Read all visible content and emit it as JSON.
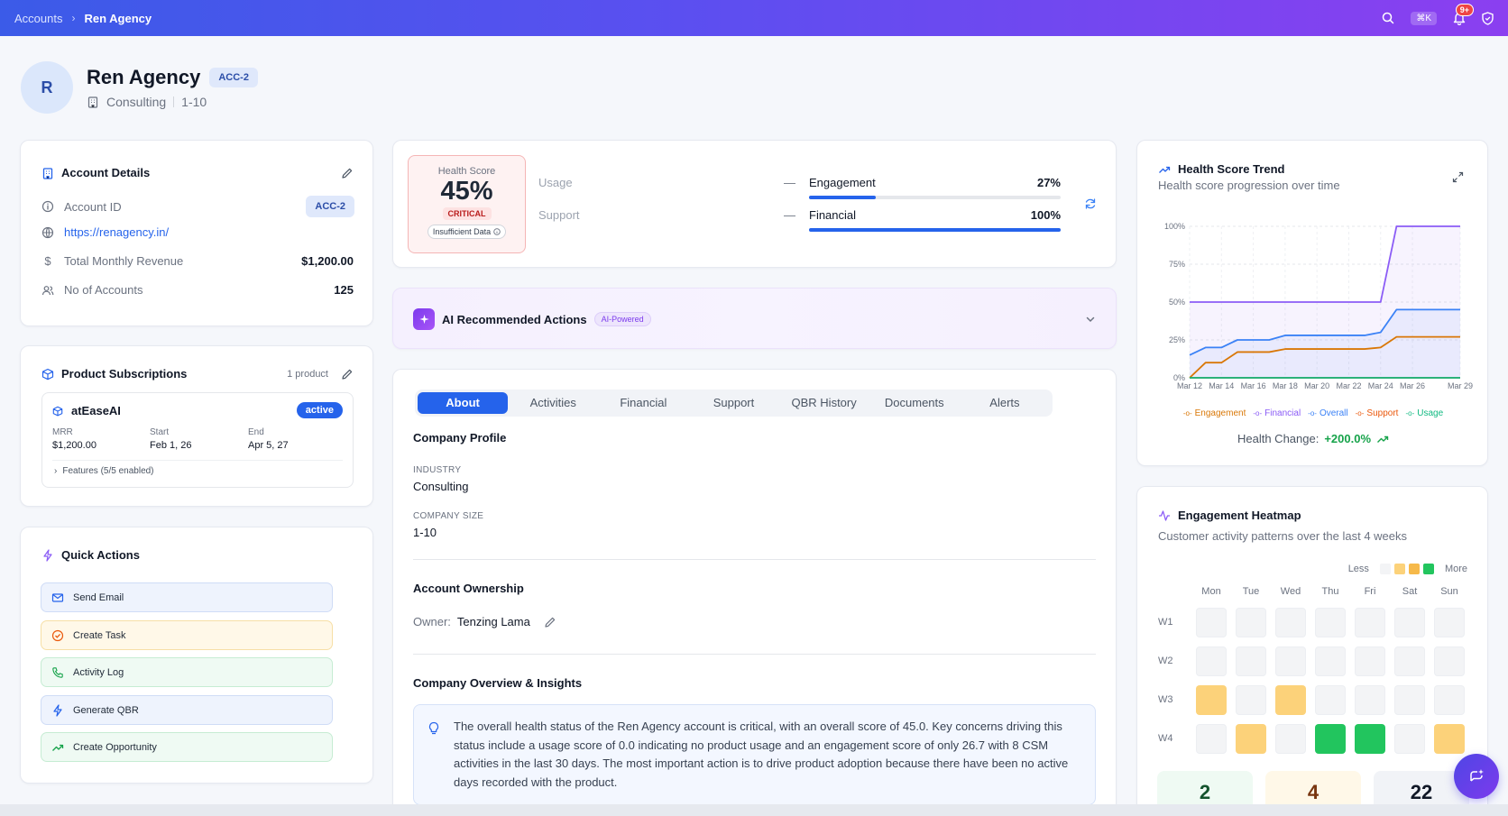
{
  "breadcrumb": {
    "parent": "Accounts",
    "current": "Ren Agency"
  },
  "topbar": {
    "kbd": "⌘K",
    "notifications": "9+"
  },
  "account": {
    "initial": "R",
    "name": "Ren Agency",
    "code": "ACC-2",
    "industry": "Consulting",
    "size": "1-10"
  },
  "details": {
    "title": "Account Details",
    "account_id_label": "Account ID",
    "account_id": "ACC-2",
    "website": "https://renagency.in/",
    "mrr_label": "Total Monthly Revenue",
    "mrr": "$1,200.00",
    "accounts_label": "No of Accounts",
    "accounts": "125"
  },
  "subscriptions": {
    "title": "Product Subscriptions",
    "count": "1 product",
    "product": "atEaseAI",
    "status": "active",
    "mrr_label": "MRR",
    "mrr": "$1,200.00",
    "start_label": "Start",
    "start": "Feb 1, 26",
    "end_label": "End",
    "end": "Apr 5, 27",
    "features": "Features (5/5 enabled)"
  },
  "quick_actions": {
    "title": "Quick Actions",
    "items": [
      "Send Email",
      "Create Task",
      "Activity Log",
      "Generate QBR",
      "Create Opportunity"
    ]
  },
  "health": {
    "label": "Health Score",
    "score": "45%",
    "status": "CRITICAL",
    "note": "Insufficient Data",
    "usage_label": "Usage",
    "usage_value": "—",
    "support_label": "Support",
    "support_value": "—",
    "engagement_label": "Engagement",
    "engagement_pct": "27%",
    "engagement_fill": 0.267,
    "financial_label": "Financial",
    "financial_pct": "100%",
    "financial_fill": 1.0
  },
  "ai": {
    "title": "AI Recommended Actions",
    "badge": "AI-Powered"
  },
  "tabs": [
    "About",
    "Activities",
    "Financial",
    "Support",
    "QBR History",
    "Documents",
    "Alerts"
  ],
  "about": {
    "profile_title": "Company Profile",
    "industry_label": "INDUSTRY",
    "industry": "Consulting",
    "size_label": "COMPANY SIZE",
    "size": "1-10",
    "ownership_title": "Account Ownership",
    "owner_label": "Owner:",
    "owner": "Tenzing Lama",
    "overview_title": "Company Overview & Insights",
    "overview_text": "The overall health status of the Ren Agency account is critical, with an overall score of 45.0. Key concerns driving this status include a usage score of 0.0 indicating no product usage and an engagement score of only 26.7 with 8 CSM activities in the last 30 days. The most important action is to drive product adoption because there have been no active days recorded with the product."
  },
  "trend": {
    "title": "Health Score Trend",
    "subtitle": "Health score progression over time",
    "change_label": "Health Change:",
    "change_value": "+200.0%"
  },
  "chart_data": {
    "type": "line",
    "x": [
      "Mar 12",
      "Mar 13",
      "Mar 14",
      "Mar 15",
      "Mar 16",
      "Mar 17",
      "Mar 18",
      "Mar 19",
      "Mar 20",
      "Mar 21",
      "Mar 22",
      "Mar 23",
      "Mar 24",
      "Mar 25",
      "Mar 26",
      "Mar 27",
      "Mar 28",
      "Mar 29"
    ],
    "x_ticks": [
      "Mar 12",
      "Mar 14",
      "Mar 16",
      "Mar 18",
      "Mar 20",
      "Mar 22",
      "Mar 24",
      "Mar 26",
      "Mar 29"
    ],
    "ylim": [
      0,
      100
    ],
    "y_ticks": [
      "0%",
      "25%",
      "50%",
      "75%",
      "100%"
    ],
    "series": [
      {
        "name": "Engagement",
        "color": "#d97706",
        "values": [
          0,
          10,
          10,
          17,
          17,
          17,
          19,
          19,
          19,
          19,
          19,
          19,
          20,
          27,
          27,
          27,
          27,
          27
        ]
      },
      {
        "name": "Financial",
        "color": "#8b5cf6",
        "values": [
          50,
          50,
          50,
          50,
          50,
          50,
          50,
          50,
          50,
          50,
          50,
          50,
          50,
          100,
          100,
          100,
          100,
          100
        ]
      },
      {
        "name": "Overall",
        "color": "#3b82f6",
        "values": [
          15,
          20,
          20,
          25,
          25,
          25,
          28,
          28,
          28,
          28,
          28,
          28,
          30,
          45,
          45,
          45,
          45,
          45
        ]
      },
      {
        "name": "Support",
        "color": "#ea580c",
        "values": [
          0,
          0,
          0,
          0,
          0,
          0,
          0,
          0,
          0,
          0,
          0,
          0,
          0,
          0,
          0,
          0,
          0,
          0
        ]
      },
      {
        "name": "Usage",
        "color": "#10b981",
        "values": [
          0,
          0,
          0,
          0,
          0,
          0,
          0,
          0,
          0,
          0,
          0,
          0,
          0,
          0,
          0,
          0,
          0,
          0
        ]
      }
    ],
    "legend": "bottom"
  },
  "heatmap": {
    "title": "Engagement Heatmap",
    "subtitle": "Customer activity patterns over the last 4 weeks",
    "less": "Less",
    "more": "More",
    "days": [
      "Mon",
      "Tue",
      "Wed",
      "Thu",
      "Fri",
      "Sat",
      "Sun"
    ],
    "weeks": [
      "W1",
      "W2",
      "W3",
      "W4"
    ],
    "levels": [
      [
        0,
        0,
        0,
        0,
        0,
        0,
        0
      ],
      [
        0,
        0,
        0,
        0,
        0,
        0,
        0
      ],
      [
        1,
        0,
        1,
        0,
        0,
        0,
        0
      ],
      [
        0,
        1,
        0,
        3,
        3,
        0,
        1
      ]
    ],
    "level_colors": [
      "#f3f4f6",
      "#fcd27a",
      "#f6b94a",
      "#22c55e"
    ],
    "stats": [
      "2",
      "4",
      "22"
    ]
  }
}
